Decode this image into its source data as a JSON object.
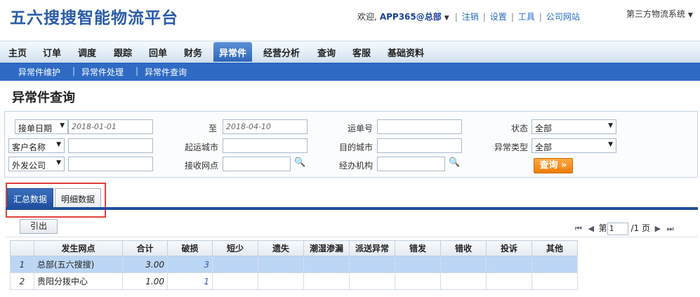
{
  "header": {
    "logo": "五六搜搜智能物流平台",
    "welcome": "欢迎,",
    "user": "APP365@总部",
    "links": [
      "注销",
      "设置",
      "工具",
      "公司网站"
    ],
    "system_menu": "第三方物流系统"
  },
  "nav": {
    "items": [
      "主页",
      "订单",
      "调度",
      "跟踪",
      "回单",
      "财务",
      "异常件",
      "经营分析",
      "查询",
      "客服",
      "基础资料"
    ],
    "active": "异常件"
  },
  "subnav": {
    "items": [
      "异常件维护",
      "异常件处理",
      "异常件查询"
    ]
  },
  "page_title": "异常件查询",
  "filters": {
    "date_type": "接单日期",
    "date_from": "2018-01-01",
    "to_label": "至",
    "date_to": "2018-04-10",
    "waybill_label": "运单号",
    "status_label": "状态",
    "status_value": "全部",
    "customer_select": "客户名称",
    "origin_label": "起运城市",
    "dest_label": "目的城市",
    "exception_type_label": "异常类型",
    "exception_type_value": "全部",
    "outsource_select": "外发公司",
    "receive_point_label": "接收网点",
    "handler_label": "经办机构",
    "query_button": "查询 »"
  },
  "tabs": [
    "汇总数据",
    "明细数据"
  ],
  "toolbar": {
    "export": "引出",
    "page_prefix": "第",
    "page_value": "1",
    "page_suffix": "/1 页"
  },
  "table": {
    "columns": [
      "发生网点",
      "合计",
      "破损",
      "短少",
      "遗失",
      "潮湿渗漏",
      "派送异常",
      "错发",
      "错收",
      "投诉",
      "其他"
    ],
    "rows": [
      {
        "no": "1",
        "site": "总部(五六搜搜)",
        "total": "3.00",
        "damage": "3"
      },
      {
        "no": "2",
        "site": "贵阳分拨中心",
        "total": "1.00",
        "damage": "1"
      }
    ]
  },
  "colors": {
    "brand": "#2a5ca8",
    "subnav": "#2f6bc4",
    "query_button": "#f07d07",
    "highlight": "#e0403c"
  }
}
